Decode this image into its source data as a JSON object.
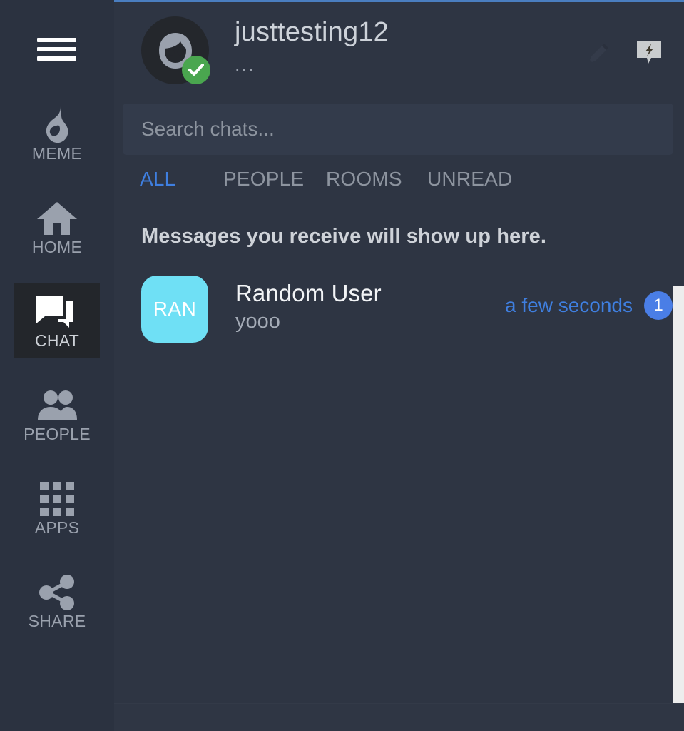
{
  "theme": {
    "sidebar_bg": "#2b3240",
    "main_bg": "#2e3543",
    "accent_blue": "#3f7fe0",
    "top_border": "#4a7ec0",
    "active_nav_bg": "#23262b",
    "avatar_cyan": "#6fe0f5",
    "verified_green": "#4aa64f",
    "text_primary": "#cdd2d9",
    "text_muted": "#8d949f"
  },
  "sidebar": {
    "menu_icon": "hamburger-menu-icon",
    "items": [
      {
        "label": "MEME",
        "icon": "flame-icon",
        "active": false
      },
      {
        "label": "HOME",
        "icon": "house-icon",
        "active": false
      },
      {
        "label": "CHAT",
        "icon": "chat-bubbles-icon",
        "active": true
      },
      {
        "label": "PEOPLE",
        "icon": "people-icon",
        "active": false
      },
      {
        "label": "APPS",
        "icon": "grid-apps-icon",
        "active": false
      },
      {
        "label": "SHARE",
        "icon": "share-nodes-icon",
        "active": false
      }
    ]
  },
  "header": {
    "avatar_icon": "user-face-avatar",
    "verified_icon": "check-badge-icon",
    "username": "justtesting12",
    "status": "...",
    "actions": [
      {
        "name": "edit-profile",
        "icon": "pencil-icon"
      },
      {
        "name": "quick-chat",
        "icon": "chat-lightning-icon"
      }
    ]
  },
  "search": {
    "placeholder": "Search chats...",
    "value": ""
  },
  "tabs": [
    {
      "label": "ALL",
      "active": true
    },
    {
      "label": "PEOPLE",
      "active": false
    },
    {
      "label": "ROOMS",
      "active": false
    },
    {
      "label": "UNREAD",
      "active": false
    }
  ],
  "main": {
    "empty_hint": "Messages you receive will show up here."
  },
  "chats": [
    {
      "initials": "RAN",
      "name": "Random User",
      "preview": "yooo",
      "time": "a few seconds",
      "unread": "1"
    }
  ]
}
